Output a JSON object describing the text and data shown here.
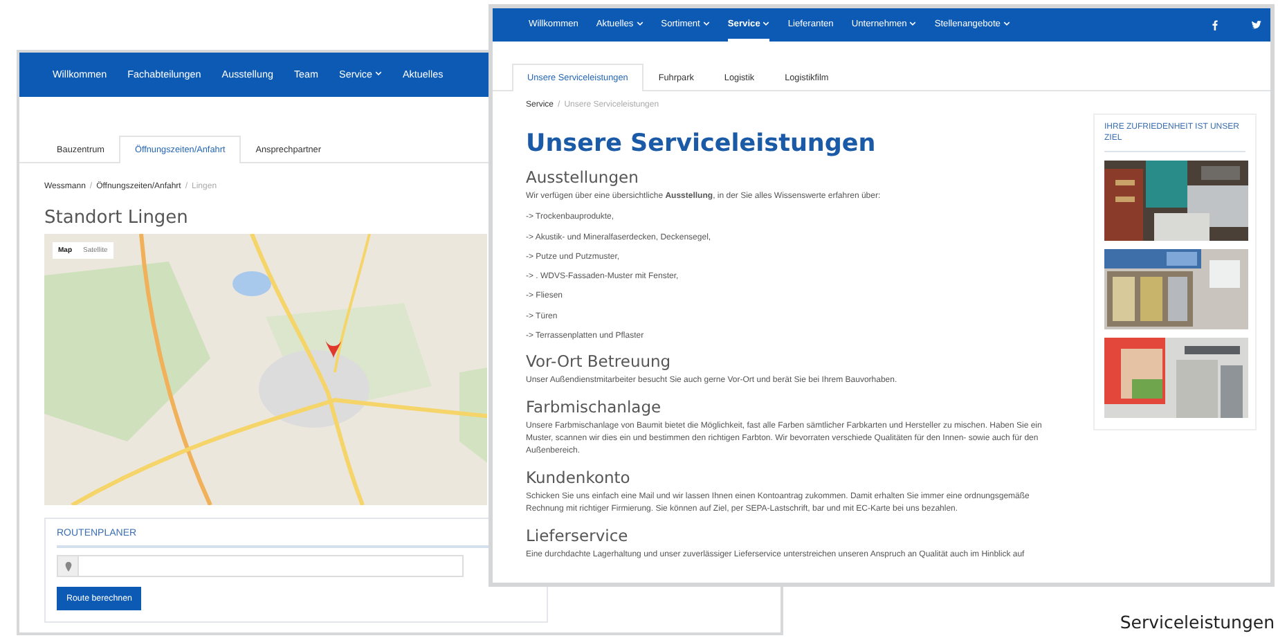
{
  "back_window": {
    "nav": [
      {
        "label": "Willkommen",
        "dropdown": false
      },
      {
        "label": "Fachabteilungen",
        "dropdown": false
      },
      {
        "label": "Ausstellung",
        "dropdown": false
      },
      {
        "label": "Team",
        "dropdown": false
      },
      {
        "label": "Service",
        "dropdown": true
      },
      {
        "label": "Aktuelles",
        "dropdown": false
      }
    ],
    "tabs": [
      {
        "label": "Bauzentrum",
        "selected": false
      },
      {
        "label": "Öffnungszeiten/Anfahrt",
        "selected": true
      },
      {
        "label": "Ansprechpartner",
        "selected": false
      }
    ],
    "breadcrumb": {
      "separator": "/",
      "items": [
        {
          "label": "Wessmann",
          "current": false
        },
        {
          "label": "Öffnungszeiten/Anfahrt",
          "current": false
        },
        {
          "label": "Lingen",
          "current": true
        }
      ]
    },
    "heading": "Standort Lingen",
    "map": {
      "kind": "picture",
      "map_type": [
        {
          "label": "Map",
          "selected": true
        },
        {
          "label": "Satellite",
          "selected": false
        }
      ]
    },
    "route_planner": {
      "title": "ROUTENPLANER",
      "button": "Route berechnen"
    }
  },
  "front_window": {
    "nav": [
      {
        "label": "Willkommen",
        "dropdown": false,
        "selected": false
      },
      {
        "label": "Aktuelles",
        "dropdown": true,
        "selected": false
      },
      {
        "label": "Sortiment",
        "dropdown": true,
        "selected": false
      },
      {
        "label": "Service",
        "dropdown": true,
        "selected": true
      },
      {
        "label": "Lieferanten",
        "dropdown": false,
        "selected": false
      },
      {
        "label": "Unternehmen",
        "dropdown": true,
        "selected": false
      },
      {
        "label": "Stellenangebote",
        "dropdown": true,
        "selected": false
      }
    ],
    "social": [
      {
        "kind": "f"
      },
      {
        "kind": "bird"
      }
    ],
    "tabs": [
      {
        "label": "Unsere Serviceleistungen",
        "selected": true
      },
      {
        "label": "Fuhrpark",
        "selected": false
      },
      {
        "label": "Logistik",
        "selected": false
      },
      {
        "label": "Logistikfilm",
        "selected": false
      }
    ],
    "breadcrumb": {
      "separator": "/",
      "items": [
        {
          "label": "Service",
          "current": false
        },
        {
          "label": "Unsere Serviceleistungen",
          "current": true
        }
      ]
    },
    "title": "Unsere Serviceleistungen",
    "sections": [
      {
        "heading": "Ausstellungen",
        "paragraph": "Wir verfügen über eine übersichtliche **Ausstellung**, in der Sie alles Wissenswerte erfahren über:",
        "items": [
          "-> Trockenbauprodukte,",
          "-> Akustik- und Mineralfaserdecken, Deckensegel,",
          "-> Putze und Putzmuster,",
          "-> . WDVS-Fassaden-Muster mit Fenster,",
          "-> Fliesen",
          "-> Türen",
          "-> Terrassenplatten und Pflaster"
        ]
      },
      {
        "heading": "Vor-Ort Betreuung",
        "paragraph": "Unser Außendienstmitarbeiter besucht Sie auch gerne Vor-Ort und berät Sie bei Ihrem Bauvorhaben."
      },
      {
        "heading": "Farbmischanlage",
        "paragraph": "Unsere Farbmischanlage von Baumit bietet die Möglichkeit, fast alle Farben sämtlicher Farbkarten und Hersteller zu mischen. Haben Sie ein Muster, scannen wir dies ein und bestimmen den richtigen Farbton. Wir bevorraten verschiede Qualitäten für den Innen- sowie auch für den Außenbereich."
      },
      {
        "heading": "Kundenkonto",
        "paragraph": "Schicken Sie uns einfach eine Mail und wir lassen Ihnen einen Kontoantrag zukommen. Damit erhalten Sie immer eine ordnungsgemäße Rechnung mit richtiger Firmierung. Sie können auf Ziel, per SEPA-Lastschrift, bar und mit EC-Karte bei uns bezahlen."
      },
      {
        "heading": "Lieferservice",
        "paragraph": "Eine durchdachte Lagerhaltung und unser zuverlässiger Lieferservice unterstreichen unseren Anspruch an Qualität auch im Hinblick auf"
      }
    ],
    "sidebar": {
      "title": "IHRE ZUFRIEDENHEIT IST UNSER ZIEL"
    }
  },
  "caption": "Serviceleistungen"
}
